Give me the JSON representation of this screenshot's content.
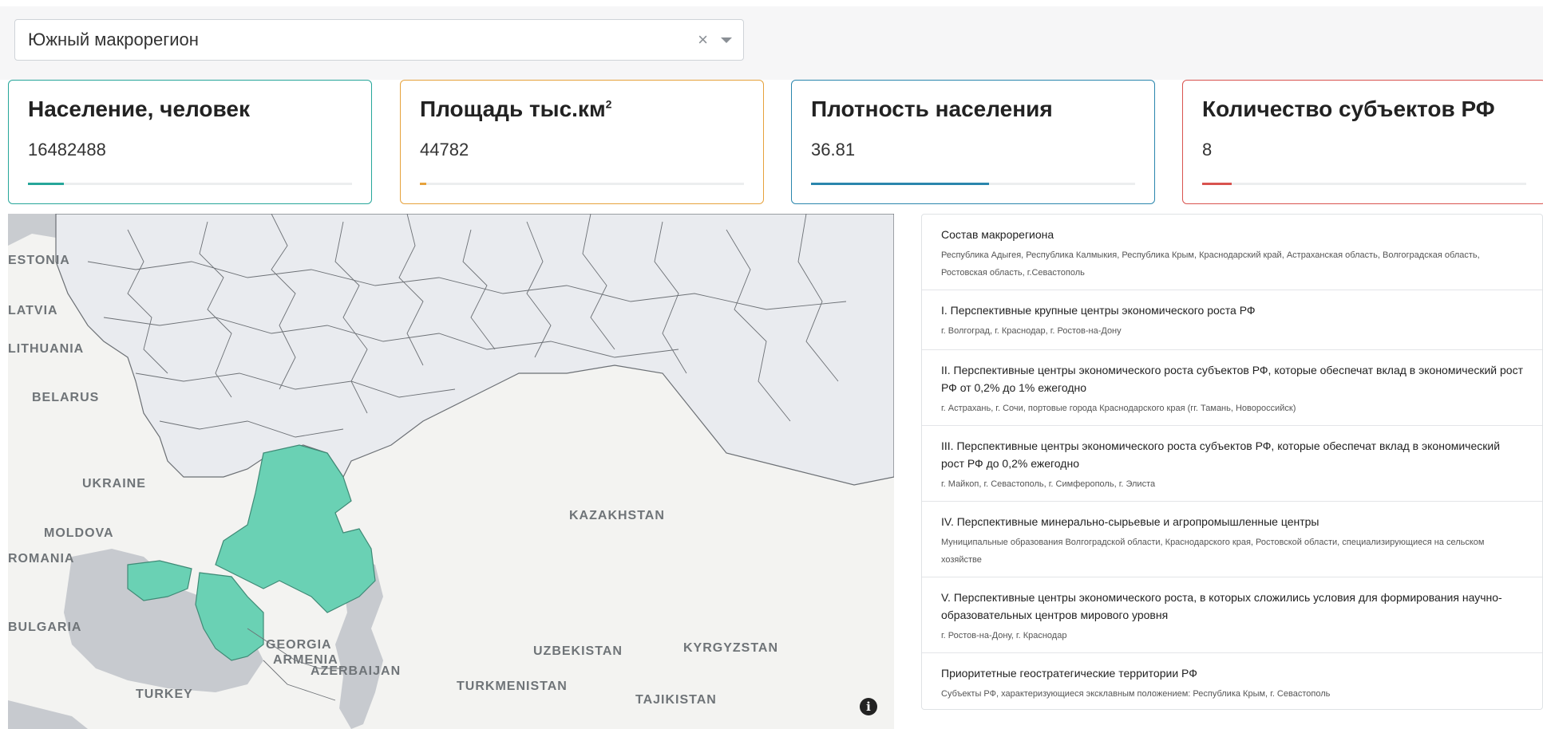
{
  "filter": {
    "selected": "Южный макрорегион",
    "clear_symbol": "×"
  },
  "cards": [
    {
      "title": "Население, человек",
      "value": "16482488",
      "color": "#26a69a",
      "progress": 0.11
    },
    {
      "title": "Площадь тыс.км",
      "title_sup": "2",
      "value": "44782",
      "color": "#e6a23c",
      "progress": 0.02
    },
    {
      "title": "Плотность населения",
      "value": "36.81",
      "color": "#2a86ad",
      "progress": 0.55
    },
    {
      "title": "Количество субъектов РФ",
      "value": "8",
      "color": "#d9534f",
      "progress": 0.09
    }
  ],
  "map": {
    "labels": [
      "ESTONIA",
      "LATVIA",
      "LITHUANIA",
      "BELARUS",
      "UKRAINE",
      "MOLDOVA",
      "ROMANIA",
      "BULGARIA",
      "GEORGIA",
      "ARMENIA",
      "AZERBAIJAN",
      "TURKEY",
      "KAZAKHSTAN",
      "UZBEKISTAN",
      "TURKMENISTAN",
      "KYRGYZSTAN",
      "TAJIKISTAN"
    ],
    "highlight_color": "#6ad1b4",
    "info_icon": "info-icon"
  },
  "panel": {
    "items": [
      {
        "title": "Состав макрорегиона",
        "desc": "Республика Адыгея, Республика Калмыкия, Республика Крым, Краснодарский край, Астраханская область, Волгоградская область, Ростовская область, г.Севастополь"
      },
      {
        "title": "I. Перспективные крупные центры экономического роста РФ",
        "desc": "г. Волгоград, г. Краснодар, г. Ростов-на-Дону"
      },
      {
        "title": "II. Перспективные центры экономического роста субъектов РФ, которые обеспечат вклад в экономический рост РФ от 0,2% до 1% ежегодно",
        "desc": "г. Астрахань, г. Сочи, портовые города Краснодарского края (гг. Тамань, Новороссийск)"
      },
      {
        "title": "III. Перспективные центры экономического роста субъектов РФ, которые обеспечат вклад в экономический рост РФ до 0,2% ежегодно",
        "desc": "г. Майкоп, г. Севастополь, г. Симферополь, г. Элиста"
      },
      {
        "title": "IV. Перспективные минерально-сырьевые и агропромышленные центры",
        "desc": "Муниципальные образования Волгоградской области, Краснодарского края, Ростовской области, специализирующиеся на сельском хозяйстве"
      },
      {
        "title": "V. Перспективные центры экономического роста, в которых сложились условия для формирования научно-образовательных центров мирового уровня",
        "desc": "г. Ростов-на-Дону, г. Краснодар"
      },
      {
        "title": "Приоритетные геостратегические территории РФ",
        "desc": "Субъекты РФ, характеризующиеся эксклавным положением: Республика Крым, г. Севастополь"
      }
    ]
  }
}
